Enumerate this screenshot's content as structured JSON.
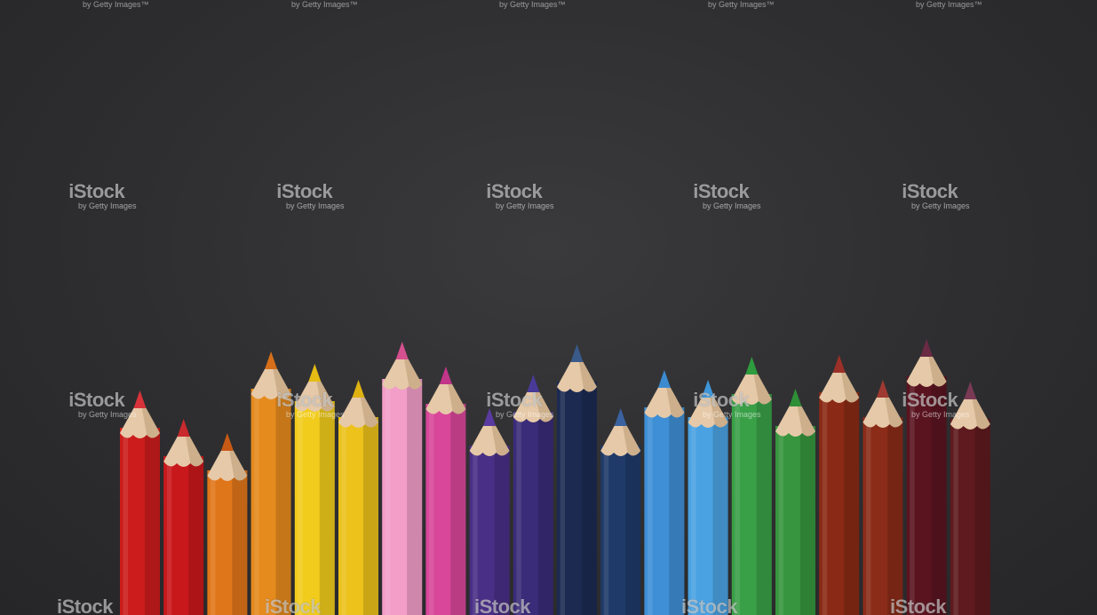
{
  "watermark": {
    "brand": "iStock",
    "sub": "by Getty Images",
    "sub_top": "by Getty Images™"
  },
  "background_color": "#2e2e30",
  "pencils": [
    {
      "color": "#cc1c1c",
      "tip": "#d8333a"
    },
    {
      "color": "#c9181b",
      "tip": "#c82a2e"
    },
    {
      "color": "#e0761a",
      "tip": "#c85a16"
    },
    {
      "color": "#e58a1d",
      "tip": "#d66e1a"
    },
    {
      "color": "#f2cc1d",
      "tip": "#e6bc14"
    },
    {
      "color": "#ecc21b",
      "tip": "#dfb212"
    },
    {
      "color": "#f29ec8",
      "tip": "#d4508e"
    },
    {
      "color": "#d9479a",
      "tip": "#c2368a"
    },
    {
      "color": "#4a2f86",
      "tip": "#5a3aa0"
    },
    {
      "color": "#3a2c78",
      "tip": "#4a3a98"
    },
    {
      "color": "#1c2a52",
      "tip": "#3a5a8a"
    },
    {
      "color": "#1f3a68",
      "tip": "#3a62a0"
    },
    {
      "color": "#3f8fd6",
      "tip": "#3c8bd0"
    },
    {
      "color": "#4aa2e2",
      "tip": "#3f96d8"
    },
    {
      "color": "#3aa048",
      "tip": "#2e9c3e"
    },
    {
      "color": "#36953e",
      "tip": "#2e8f37"
    },
    {
      "color": "#8a2a16",
      "tip": "#9a3028"
    },
    {
      "color": "#8a2c18",
      "tip": "#9e3a32"
    },
    {
      "color": "#5a1420",
      "tip": "#6a2a44"
    },
    {
      "color": "#5e1a1e",
      "tip": "#7a3a56"
    }
  ]
}
